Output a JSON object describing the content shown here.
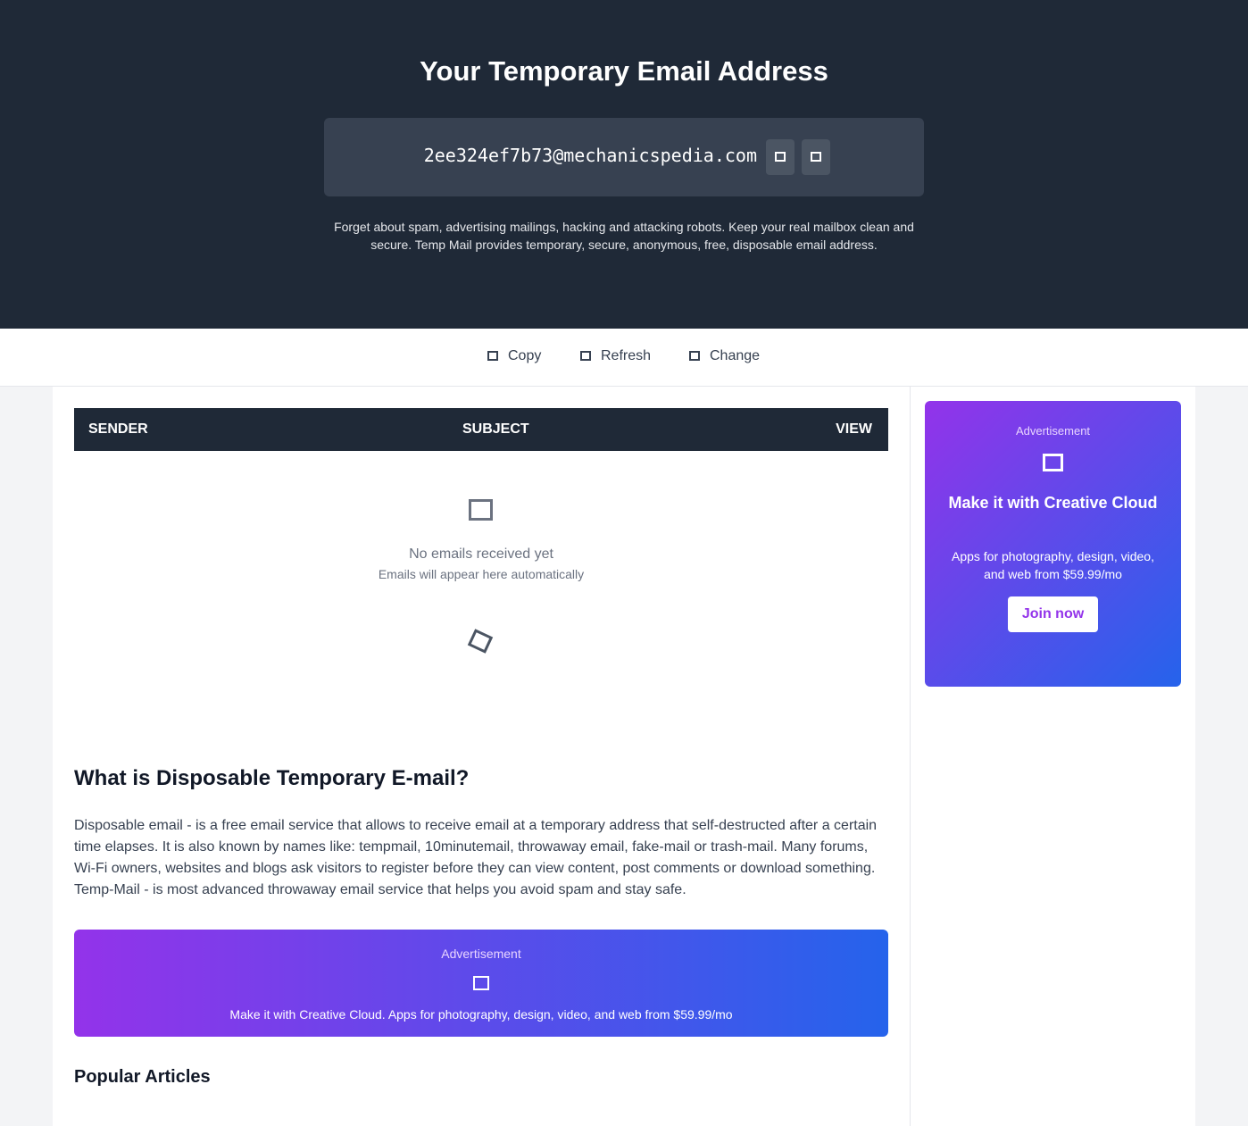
{
  "hero": {
    "title": "Your Temporary Email Address",
    "email": "2ee324ef7b73@mechanicspedia.com",
    "email_buttons": [
      {
        "icon": "copy-icon"
      },
      {
        "icon": "refresh-icon"
      }
    ],
    "description": "Forget about spam, advertising mailings, hacking and attacking robots. Keep your real mailbox clean and secure. Temp Mail provides temporary, secure, anonymous, free, disposable email address."
  },
  "actions": [
    {
      "label": "Copy",
      "icon": "copy-icon"
    },
    {
      "label": "Refresh",
      "icon": "refresh-icon"
    },
    {
      "label": "Change",
      "icon": "edit-icon"
    }
  ],
  "inbox": {
    "columns": [
      "SENDER",
      "SUBJECT",
      "VIEW"
    ],
    "empty_icon": "inbox-icon",
    "empty_title": "No emails received yet",
    "empty_subtitle": "Emails will appear here automatically",
    "loading_icon": "spinner-icon"
  },
  "content": {
    "title": "What is Disposable Temporary E-mail?",
    "text": "Disposable email - is a free email service that allows to receive email at a temporary address that self-destructed after a certain time elapses. It is also known by names like: tempmail, 10minutemail, throwaway email, fake-mail or trash-mail. Many forums, Wi-Fi owners, websites and blogs ask visitors to register before they can view content, post comments or download something. Temp-Mail - is most advanced throwaway email service that helps you avoid spam and stay safe.",
    "popular_title": "Popular Articles"
  },
  "ad_wide": {
    "label": "Advertisement",
    "icon": "ad-icon",
    "text": "Make it with Creative Cloud. Apps for photography, design, video, and web from $59.99/mo"
  },
  "ad_side": {
    "label": "Advertisement",
    "icon": "ad-icon",
    "title": "Make it with Creative Cloud",
    "text": "Apps for photography, design, video, and web from $59.99/mo",
    "button": "Join now"
  },
  "colors": {
    "hero_bg": "#1f2937",
    "ad_gradient_start": "#9333ea",
    "ad_gradient_end": "#2563eb"
  }
}
